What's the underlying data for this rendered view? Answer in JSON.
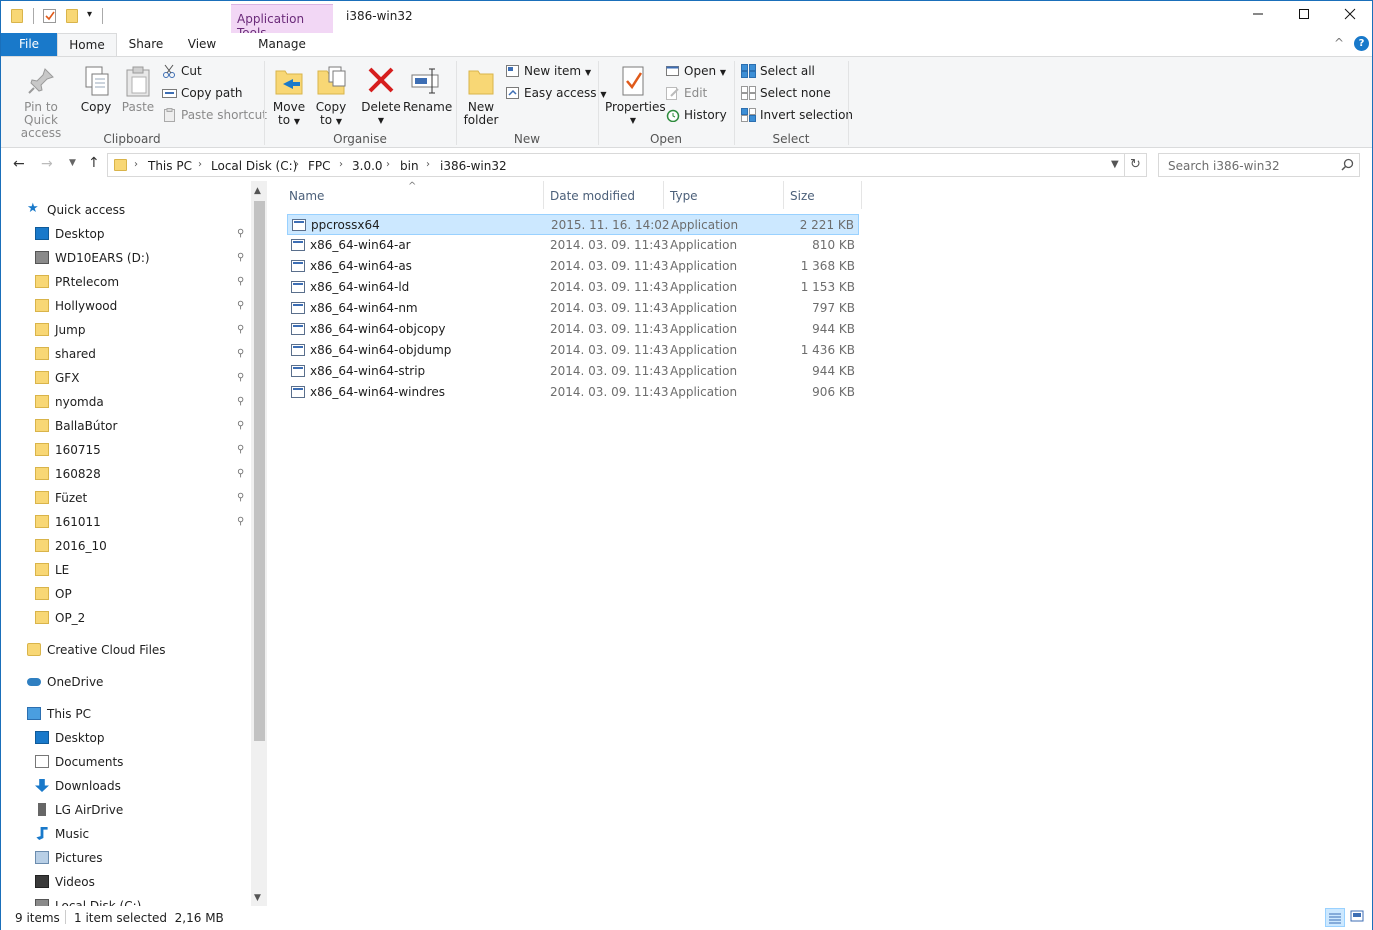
{
  "window": {
    "title": "i386-win32",
    "context_tab": "Application Tools",
    "accent": "#1979ca"
  },
  "tabs": {
    "file": "File",
    "home": "Home",
    "share": "Share",
    "view": "View",
    "manage": "Manage"
  },
  "ribbon": {
    "clipboard": {
      "label": "Clipboard",
      "pin": "Pin to Quick access",
      "pin_l1": "Pin to Quick",
      "pin_l2": "access",
      "copy": "Copy",
      "paste": "Paste",
      "cut": "Cut",
      "copy_path": "Copy path",
      "paste_shortcut": "Paste shortcut"
    },
    "organise": {
      "label": "Organise",
      "move_l1": "Move",
      "move_l2": "to",
      "copy_l1": "Copy",
      "copy_l2": "to",
      "delete": "Delete",
      "rename": "Rename"
    },
    "new": {
      "label": "New",
      "folder_l1": "New",
      "folder_l2": "folder",
      "new_item": "New item",
      "easy_access": "Easy access"
    },
    "open": {
      "label": "Open",
      "properties": "Properties",
      "open": "Open",
      "edit": "Edit",
      "history": "History"
    },
    "select": {
      "label": "Select",
      "select_all": "Select all",
      "select_none": "Select none",
      "invert": "Invert selection"
    }
  },
  "address": {
    "crumbs": [
      "This PC",
      "Local Disk (C:)",
      "FPC",
      "3.0.0",
      "bin",
      "i386-win32"
    ],
    "search_placeholder": "Search i386-win32"
  },
  "nav": {
    "quick_access": "Quick access",
    "pinned": [
      "Desktop",
      "WD10EARS (D:)",
      "PRtelecom",
      "Hollywood",
      "Jump",
      "shared",
      "GFX",
      "nyomda",
      "BallaBútor",
      "160715",
      "160828",
      "Füzet",
      "161011"
    ],
    "unpinned": [
      "2016_10",
      "LE",
      "OP",
      "OP_2"
    ],
    "creative_cloud": "Creative Cloud Files",
    "onedrive": "OneDrive",
    "this_pc": "This PC",
    "pc_items": [
      "Desktop",
      "Documents",
      "Downloads",
      "LG AirDrive",
      "Music",
      "Pictures",
      "Videos",
      "Local Disk (C:)"
    ]
  },
  "columns": {
    "name": "Name",
    "date": "Date modified",
    "type": "Type",
    "size": "Size"
  },
  "files": [
    {
      "name": "ppcrossx64",
      "date": "2015. 11. 16. 14:02",
      "type": "Application",
      "size": "2 221 KB",
      "selected": true
    },
    {
      "name": "x86_64-win64-ar",
      "date": "2014. 03. 09. 11:43",
      "type": "Application",
      "size": "810 KB"
    },
    {
      "name": "x86_64-win64-as",
      "date": "2014. 03. 09. 11:43",
      "type": "Application",
      "size": "1 368 KB"
    },
    {
      "name": "x86_64-win64-ld",
      "date": "2014. 03. 09. 11:43",
      "type": "Application",
      "size": "1 153 KB"
    },
    {
      "name": "x86_64-win64-nm",
      "date": "2014. 03. 09. 11:43",
      "type": "Application",
      "size": "797 KB"
    },
    {
      "name": "x86_64-win64-objcopy",
      "date": "2014. 03. 09. 11:43",
      "type": "Application",
      "size": "944 KB"
    },
    {
      "name": "x86_64-win64-objdump",
      "date": "2014. 03. 09. 11:43",
      "type": "Application",
      "size": "1 436 KB"
    },
    {
      "name": "x86_64-win64-strip",
      "date": "2014. 03. 09. 11:43",
      "type": "Application",
      "size": "944 KB"
    },
    {
      "name": "x86_64-win64-windres",
      "date": "2014. 03. 09. 11:43",
      "type": "Application",
      "size": "906 KB"
    }
  ],
  "status": {
    "count": "9 items",
    "selection": "1 item selected  2,16 MB"
  }
}
